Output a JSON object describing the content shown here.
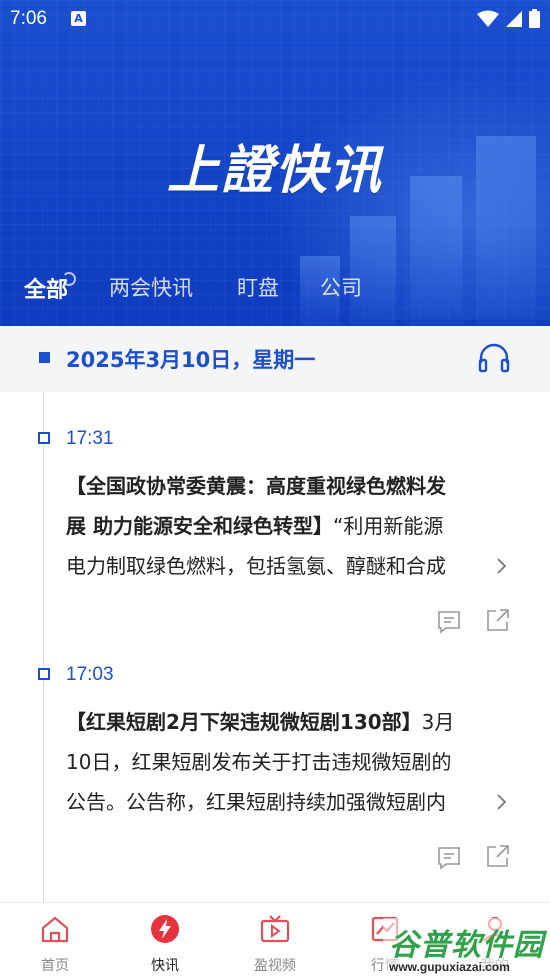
{
  "status_bar": {
    "time": "7:06",
    "notification_badge": "A"
  },
  "header": {
    "logo_text": "上證快讯",
    "tabs": [
      {
        "label": "全部",
        "active": true
      },
      {
        "label": "两会快讯",
        "active": false
      },
      {
        "label": "盯盘",
        "active": false
      },
      {
        "label": "公司",
        "active": false
      }
    ],
    "brand_color": "#1446c8"
  },
  "date_bar": {
    "date": "2025年3月10日，星期一",
    "audio_icon": "headphone-icon",
    "accent_color": "#1d4fcc"
  },
  "news": [
    {
      "time": "17:31",
      "lines": [
        {
          "headline": "【全国政协常委黄震：高度重视绿色燃料发",
          "text": ""
        },
        {
          "headline": "展 助力能源安全和绿色转型】",
          "text": "“利用新能源"
        },
        {
          "headline": "",
          "text": "电力制取绿色燃料，包括氢氨、醇醚和合成"
        }
      ],
      "actions": [
        "comment-icon",
        "share-icon"
      ]
    },
    {
      "time": "17:03",
      "lines": [
        {
          "headline": "【红果短剧2月下架违规微短剧130部】",
          "text": "3月"
        },
        {
          "headline": "",
          "text": "10日，红果短剧发布关于打击违规微短剧的"
        },
        {
          "headline": "",
          "text": "公告。公告称，红果短剧持续加强微短剧内"
        }
      ],
      "actions": [
        "comment-icon",
        "share-icon"
      ]
    }
  ],
  "bottom_nav": [
    {
      "label": "首页",
      "icon": "home-icon",
      "active": false
    },
    {
      "label": "快讯",
      "icon": "flash-icon",
      "active": true
    },
    {
      "label": "盈视频",
      "icon": "tv-icon",
      "active": false
    },
    {
      "label": "行情",
      "icon": "chart-icon",
      "active": false
    },
    {
      "label": "我的",
      "icon": "user-icon",
      "active": false
    }
  ],
  "watermark": {
    "title": "谷普软件园",
    "url": "www.gupuxiazai.com"
  }
}
